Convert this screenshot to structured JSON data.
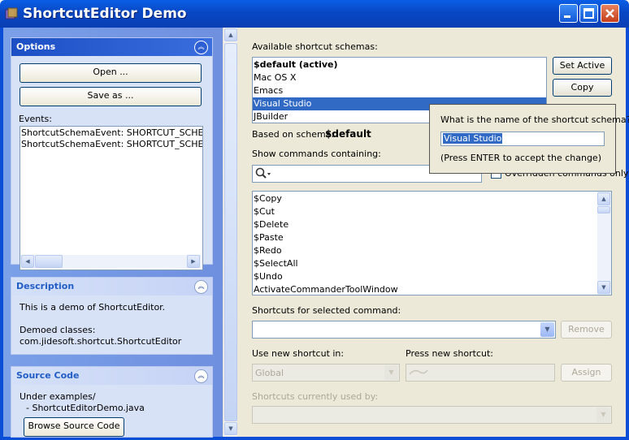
{
  "window": {
    "title": "ShortcutEditor Demo",
    "controls": {
      "minimize": "minimize-icon",
      "maximize": "maximize-icon",
      "close": "close-icon"
    }
  },
  "options_panel": {
    "title": "Options",
    "open_label": "Open ...",
    "save_label": "Save as ...",
    "events_label": "Events:",
    "events": [
      "ShortcutSchemaEvent: SHORTCUT_SCHEMA_I",
      "ShortcutSchemaEvent: SHORTCUT_SCHEMA_I"
    ]
  },
  "description_panel": {
    "title": "Description",
    "text": "This is a demo of ShortcutEditor.",
    "classes_label": "Demoed classes:",
    "classes": "com.jidesoft.shortcut.ShortcutEditor"
  },
  "source_panel": {
    "title": "Source Code",
    "line1": "Under examples/",
    "line2": "- ShortcutEditorDemo.java",
    "button": "Browse Source Code"
  },
  "schemas": {
    "label": "Available shortcut schemas:",
    "items": [
      {
        "label": "$default (active)",
        "bold": true
      },
      {
        "label": "Mac OS X"
      },
      {
        "label": "Emacs"
      },
      {
        "label": "Visual Studio",
        "selected": true
      },
      {
        "label": "JBuilder"
      }
    ],
    "set_active": "Set Active",
    "copy": "Copy",
    "based_on_label": "Based on schema:",
    "based_on_value": "$default"
  },
  "commands": {
    "filter_label": "Show commands containing:",
    "overridden_label": "Overridden commands only",
    "items": [
      "$Copy",
      "$Cut",
      "$Delete",
      "$Paste",
      "$Redo",
      "$SelectAll",
      "$Undo",
      "ActivateCommanderToolWindow"
    ]
  },
  "shortcuts": {
    "label": "Shortcuts for selected command:",
    "remove": "Remove",
    "use_in_label": "Use new shortcut in:",
    "use_in_value": "Global",
    "press_label": "Press new shortcut:",
    "assign": "Assign",
    "used_by_label": "Shortcuts currently used by:"
  },
  "rename_popup": {
    "question": "What is the name of the shortcut schema?",
    "value": "Visual Studio",
    "hint": "(Press ENTER to accept the change)"
  },
  "colors": {
    "titlebar": "#0a5fe6",
    "selection": "#316ac5",
    "taskpane": "#7aa0e8"
  }
}
